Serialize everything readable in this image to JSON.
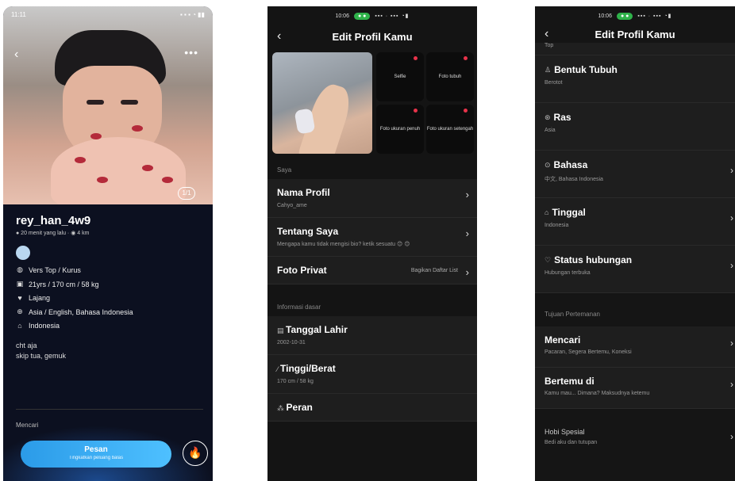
{
  "profile_view": {
    "status_time": "11:11",
    "username": "rey_han_4w9",
    "last_online": "● 20 menit yang lalu · ◉ 4 km",
    "attributes": [
      {
        "icon": "tag-icon",
        "glyph": "◍",
        "text": "Vers Top / Kurus"
      },
      {
        "icon": "body-icon",
        "glyph": "▣",
        "text": "21yrs / 170 cm / 58 kg"
      },
      {
        "icon": "heart-icon",
        "glyph": "♥",
        "text": "Lajang"
      },
      {
        "icon": "language-icon",
        "glyph": "⊕",
        "text": "Asia / English, Bahasa Indonesia"
      },
      {
        "icon": "home-icon",
        "glyph": "⌂",
        "text": "Indonesia"
      }
    ],
    "bio_line1": "cht aja",
    "bio_line2": "skip tua, gemuk",
    "looking_for_label": "Mencari",
    "message_button_label": "Pesan",
    "message_button_sub": "Tingkatkan peluang balas",
    "photo_counter": "1/1"
  },
  "edit_profile_1": {
    "status_time": "10:06",
    "title": "Edit Profil Kamu",
    "photo_slots": [
      {
        "label": "Selfie"
      },
      {
        "label": "Foto tubuh"
      },
      {
        "label": "Foto ukuran penuh"
      },
      {
        "label": "Foto ukuran setengah"
      }
    ],
    "section_saya": "Saya",
    "nama_profil": {
      "title": "Nama Profil",
      "value": "Cahyo_ame"
    },
    "tentang_saya": {
      "title": "Tentang Saya",
      "value": "Mengapa kamu tidak mengisi bio? ketik sesuatu 😊 😊"
    },
    "foto_privat": {
      "title": "Foto Privat",
      "value": "Bagikan Daftar List"
    },
    "section_info": "Informasi dasar",
    "tanggal_lahir": {
      "title": "Tanggal Lahir",
      "value": "2002-10-31"
    },
    "tinggi_berat": {
      "title": "Tinggi/Berat",
      "value": "170 cm / 58 kg"
    },
    "peran": {
      "title": "Peran"
    }
  },
  "edit_profile_2": {
    "status_time": "10:06",
    "title": "Edit Profil Kamu",
    "top_value": "Top",
    "rows": [
      {
        "icon": "body-shape-icon",
        "glyph": "♙",
        "title": "Bentuk Tubuh",
        "value": "Berotot",
        "chevron": false
      },
      {
        "icon": "race-icon",
        "glyph": "⊛",
        "title": "Ras",
        "value": "Asia",
        "chevron": false
      },
      {
        "icon": "language-icon",
        "glyph": "⊙",
        "title": "Bahasa",
        "value": "中文, Bahasa Indonesia",
        "chevron": true
      },
      {
        "icon": "location-icon",
        "glyph": "⌂",
        "title": "Tinggal",
        "value": "Indonesia",
        "chevron": true
      },
      {
        "icon": "heart-icon",
        "glyph": "♡",
        "title": "Status hubungan",
        "value": "Hubungan terbuka",
        "chevron": true
      }
    ],
    "section_tujuan": "Tujuan Pertemanan",
    "mencari": {
      "title": "Mencari",
      "value": "Pacaran, Segera Bertemu, Koneksi"
    },
    "bertemu_di": {
      "title": "Bertemu di",
      "value": "Kamu mau... Dimana? Maksudnya ketemu"
    },
    "hobi": {
      "title": "Hobi Spesial",
      "value": "Bedi aku dan tutupan"
    }
  }
}
